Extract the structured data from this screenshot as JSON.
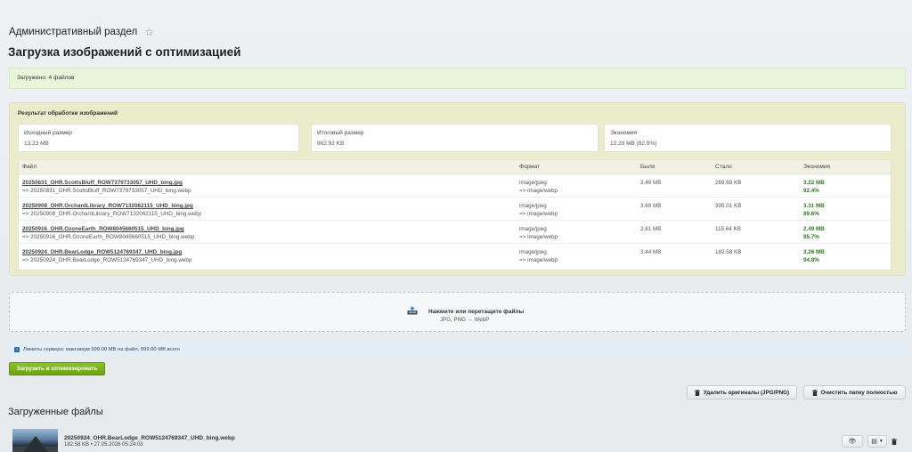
{
  "header": {
    "admin_title": "Административный раздел",
    "page_title": "Загрузка изображений с оптимизацией"
  },
  "notice": {
    "text": "Загружено: 4 файлов"
  },
  "result": {
    "title": "Результат обработки изображений",
    "stats": [
      {
        "label": "Исходный размер",
        "value": "13.23 MB"
      },
      {
        "label": "Итоговый размер",
        "value": "962.92 KB"
      },
      {
        "label": "Экономия",
        "value": "12.29 MB (92.9%)"
      }
    ],
    "columns": [
      "Файл",
      "Формат",
      "Было",
      "Стало",
      "Экономия"
    ],
    "rows": [
      {
        "file": "20250831_OHR.ScottsBluff_ROW7379733057_UHD_bing.jpg",
        "converted": "=> 20250831_OHR.ScottsBluff_ROW7379733057_UHD_bing.webp",
        "format_from": "image/jpeg",
        "format_to": "=> image/webp",
        "before": "3.49 MB",
        "after": "269.69 KB",
        "saved": "3.22 MB",
        "saved_pct": "92.4%"
      },
      {
        "file": "20250908_OHR.OrchardLibrary_ROW7132062115_UHD_bing.jpg",
        "converted": "=> 20250908_OHR.OrchardLibrary_ROW7132062115_UHD_bing.webp",
        "format_from": "image/jpeg",
        "format_to": "=> image/webp",
        "before": "3.69 MB",
        "after": "395.01 KB",
        "saved": "3.31 MB",
        "saved_pct": "89.6%"
      },
      {
        "file": "20250916_OHR.OzoneEarth_ROW8045660515_UHD_bing.jpg",
        "converted": "=> 20250916_OHR.OzoneEarth_ROW8045660515_UHD_bing.webp",
        "format_from": "image/jpeg",
        "format_to": "=> image/webp",
        "before": "2.61 MB",
        "after": "115.64 KB",
        "saved": "2.49 MB",
        "saved_pct": "95.7%"
      },
      {
        "file": "20250924_OHR.BearLodge_ROW5124769347_UHD_bing.jpg",
        "converted": "=> 20250924_OHR.BearLodge_ROW5124769347_UHD_bing.webp",
        "format_from": "image/jpeg",
        "format_to": "=> image/webp",
        "before": "3.44 MB",
        "after": "182.58 KB",
        "saved": "3.26 MB",
        "saved_pct": "94.8%"
      }
    ]
  },
  "dropzone": {
    "title": "Нажмите или перетащите файлы",
    "subtitle": "JPG, PNG → WebP",
    "icon": "upload-tray-icon"
  },
  "limits": {
    "text": "Лимиты сервера: максимум 999.00 MB на файл, 999.00 MB всего"
  },
  "actions": {
    "upload_label": "Загрузить и оптимизировать",
    "delete_originals_label": "Удалить оригиналы (JPG/PNG)",
    "clear_folder_label": "Очистить папку полностью"
  },
  "uploaded": {
    "title": "Загруженные файлы",
    "items": [
      {
        "name": "20250924_OHR.BearLodge_ROW5124769347_UHD_bing.webp",
        "meta": "182.58 KB • 27.05.2026 05:24:03"
      }
    ]
  },
  "colors": {
    "accent_green": "#7ab324",
    "saved_text": "#2f7a21",
    "notice_bg": "#e8f6d9",
    "result_bg": "#ebeccb"
  }
}
